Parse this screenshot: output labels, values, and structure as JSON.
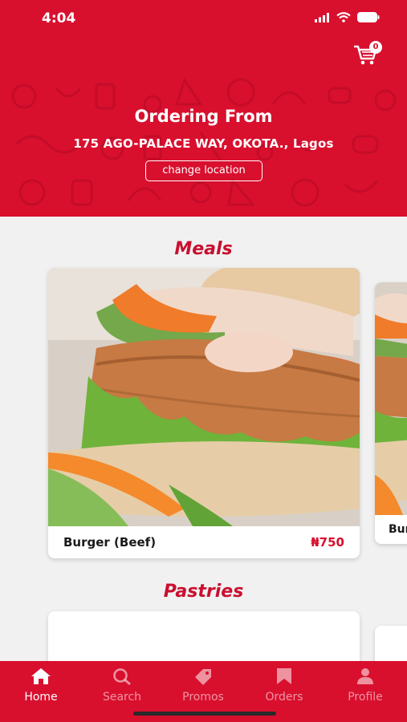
{
  "status": {
    "time": "4:04"
  },
  "header": {
    "cart_count": "0",
    "ordering_title": "Ordering From",
    "address": "175 AGO-PALACE WAY, OKOTA., Lagos",
    "change_location_label": "change location"
  },
  "sections": [
    {
      "title": "Meals",
      "items": [
        {
          "name": "Burger (Beef)",
          "price": "₦750"
        },
        {
          "name": "Bur",
          "price": ""
        }
      ]
    },
    {
      "title": "Pastries",
      "items": []
    }
  ],
  "tabs": [
    {
      "label": "Home",
      "icon": "home-icon",
      "active": true
    },
    {
      "label": "Search",
      "icon": "search-icon",
      "active": false
    },
    {
      "label": "Promos",
      "icon": "tag-icon",
      "active": false
    },
    {
      "label": "Orders",
      "icon": "bookmark-icon",
      "active": false
    },
    {
      "label": "Profile",
      "icon": "person-icon",
      "active": false
    }
  ],
  "colors": {
    "brand_red": "#d90f2e",
    "section_title": "#c8102e",
    "background": "#f1f1f2"
  }
}
